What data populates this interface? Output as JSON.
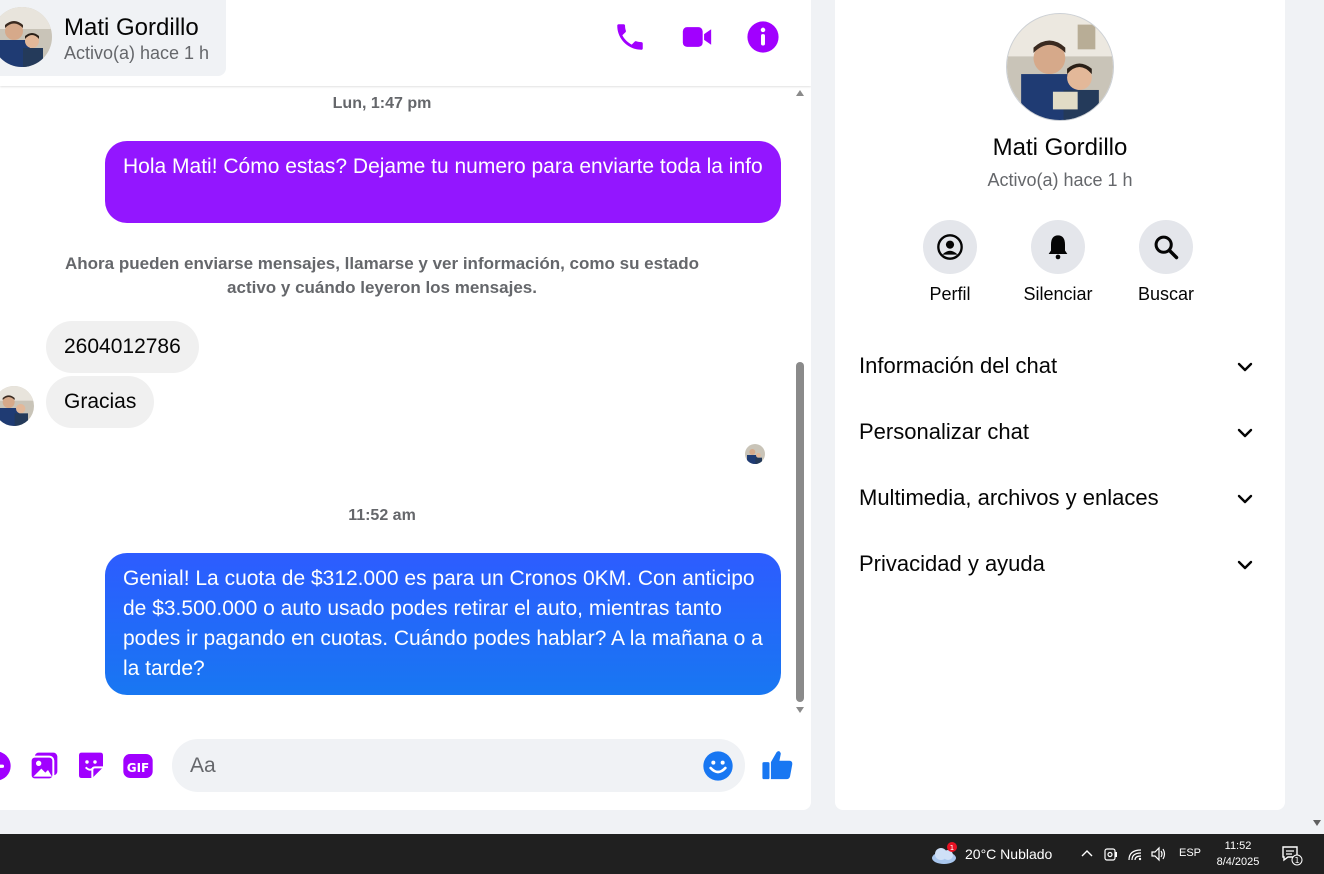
{
  "header": {
    "name": "Mati Gordillo",
    "status": "Activo(a) hace 1 h"
  },
  "messages": {
    "ts1": "Lun, 1:47 pm",
    "out1": "Hola Mati! Cómo estas? Dejame tu numero para enviarte toda la info",
    "system_note": "Ahora pueden enviarse mensajes, llamarse y ver información, como su estado activo y cuándo leyeron los mensajes.",
    "in1": "2604012786",
    "in2": "Gracias",
    "ts2": "11:52 am",
    "out2": "Genial! La cuota de $312.000 es para un Cronos 0KM. Con anticipo de $3.500.000 o auto usado podes retirar el auto, mientras tanto podes ir pagando en cuotas. Cuándo podes hablar? A la mañana o a la tarde?"
  },
  "composer": {
    "placeholder": "Aa"
  },
  "info": {
    "name": "Mati Gordillo",
    "status": "Activo(a) hace 1 h",
    "actions": [
      {
        "label": "Perfil",
        "icon": "profile-icon"
      },
      {
        "label": "Silenciar",
        "icon": "bell-icon"
      },
      {
        "label": "Buscar",
        "icon": "search-icon"
      }
    ],
    "sections": [
      {
        "label": "Información del chat"
      },
      {
        "label": "Personalizar chat"
      },
      {
        "label": "Multimedia, archivos y enlaces"
      },
      {
        "label": "Privacidad y ayuda"
      }
    ]
  },
  "taskbar": {
    "weather": "20°C  Nublado",
    "weather_badge": "1",
    "lang": "ESP",
    "time": "11:52",
    "date": "8/4/2025",
    "notif_count": "1"
  },
  "colors": {
    "accent_purple": "#9316ff",
    "messenger_blue": "#1877f2",
    "header_icon": "#a100ff"
  }
}
